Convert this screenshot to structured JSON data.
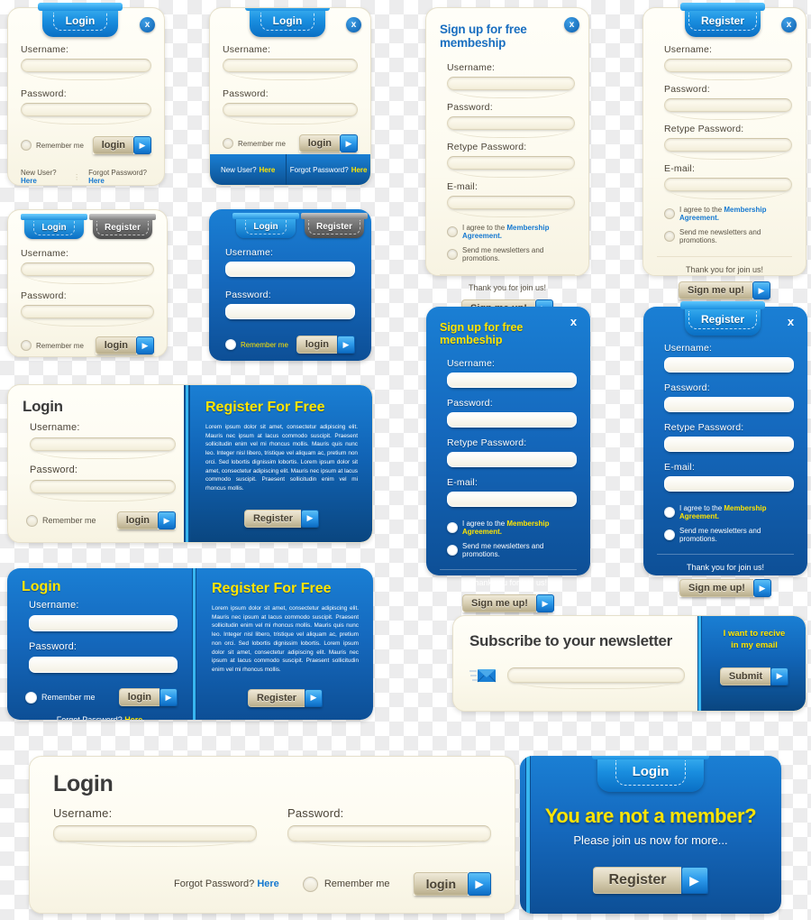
{
  "common": {
    "username_label": "Username:",
    "password_label": "Password:",
    "retype_label": "Retype Password:",
    "email_label": "E-mail:",
    "remember_label": "Remember me",
    "login_btn": "login",
    "register_btn": "Register",
    "signup_btn": "Sign me up!",
    "submit_btn": "Submit",
    "close_icon": "x",
    "arrow_icon": "▶",
    "forgot_text": "Forgot Password?",
    "newuser_text": "New User?",
    "here_text": "Here",
    "agree_text": "I agree to the ",
    "agree_link": "Membership Agreement.",
    "newsletter_opt": "Send me newsletters and promotions.",
    "thanks_text": "Thank you for join us!",
    "tab_login": "Login",
    "tab_register": "Register"
  },
  "panels": {
    "login_cream_links": {
      "title": "Login"
    },
    "login_cream_bluebar": {
      "title": "Login"
    },
    "signup_cream_plain": {
      "title": "Sign up for free membeship"
    },
    "signup_cream_tab": {
      "title": "Register"
    },
    "login_tabs_cream": {
      "active_tab": "Login",
      "inactive_tab": "Register"
    },
    "login_tabs_blue": {
      "active_tab": "Login",
      "inactive_tab": "Register"
    },
    "signup_blue_plain": {
      "title": "Sign up for free membeship"
    },
    "signup_blue_tab": {
      "title": "Register"
    },
    "combo_cream": {
      "login_title": "Login",
      "register_title": "Register For Free",
      "body": "Lorem ipsum dolor sit amet, consectetur adipiscing elit. Mauris nec ipsum at lacus commodo suscipit. Praesent sollicitudin enim vel mi rhoncus mollis. Mauris quis nunc leo. Integer nisl libero, tristique vel aliquam ac, pretium non orci. Sed lobortis dignissim lobortis. Lorem ipsum dolor sit amet, consectetur adipiscing elit. Mauris nec ipsum at lacus commodo suscipit. Praesent sollicitudin enim vel mi rhoncus mollis."
    },
    "combo_blue": {
      "login_title": "Login",
      "register_title": "Register For Free",
      "body": "Lorem ipsum dolor sit amet, consectetur adipiscing elit. Mauris nec ipsum at lacus commodo suscipit. Praesent sollicitudin enim vel mi rhoncus mollis. Mauris quis nunc leo. Integer nisl libero, tristique vel aliquam ac, pretium non orci. Sed lobortis dignissim lobortis. Lorem ipsum dolor sit amet, consectetur adipiscing elit. Mauris nec ipsum at lacus commodo suscipit. Praesent sollicitudin enim vel mi rhoncus mollis."
    },
    "newsletter": {
      "title": "Subscribe to your newsletter",
      "side_line1": "I want to recive",
      "side_line2": "in my email",
      "envelope_icon": "envelope-icon"
    },
    "wide_login": {
      "title": "Login"
    },
    "not_member": {
      "tab": "Login",
      "headline": "You are not a member?",
      "subline": "Please join us now for more...",
      "cta": "Register"
    }
  },
  "colors": {
    "accent_blue": "#1a7fd4",
    "bright_blue": "#3fb3f2",
    "cream": "#fdfbf0",
    "yellow": "#ffe400",
    "link_blue": "#1478d0"
  }
}
